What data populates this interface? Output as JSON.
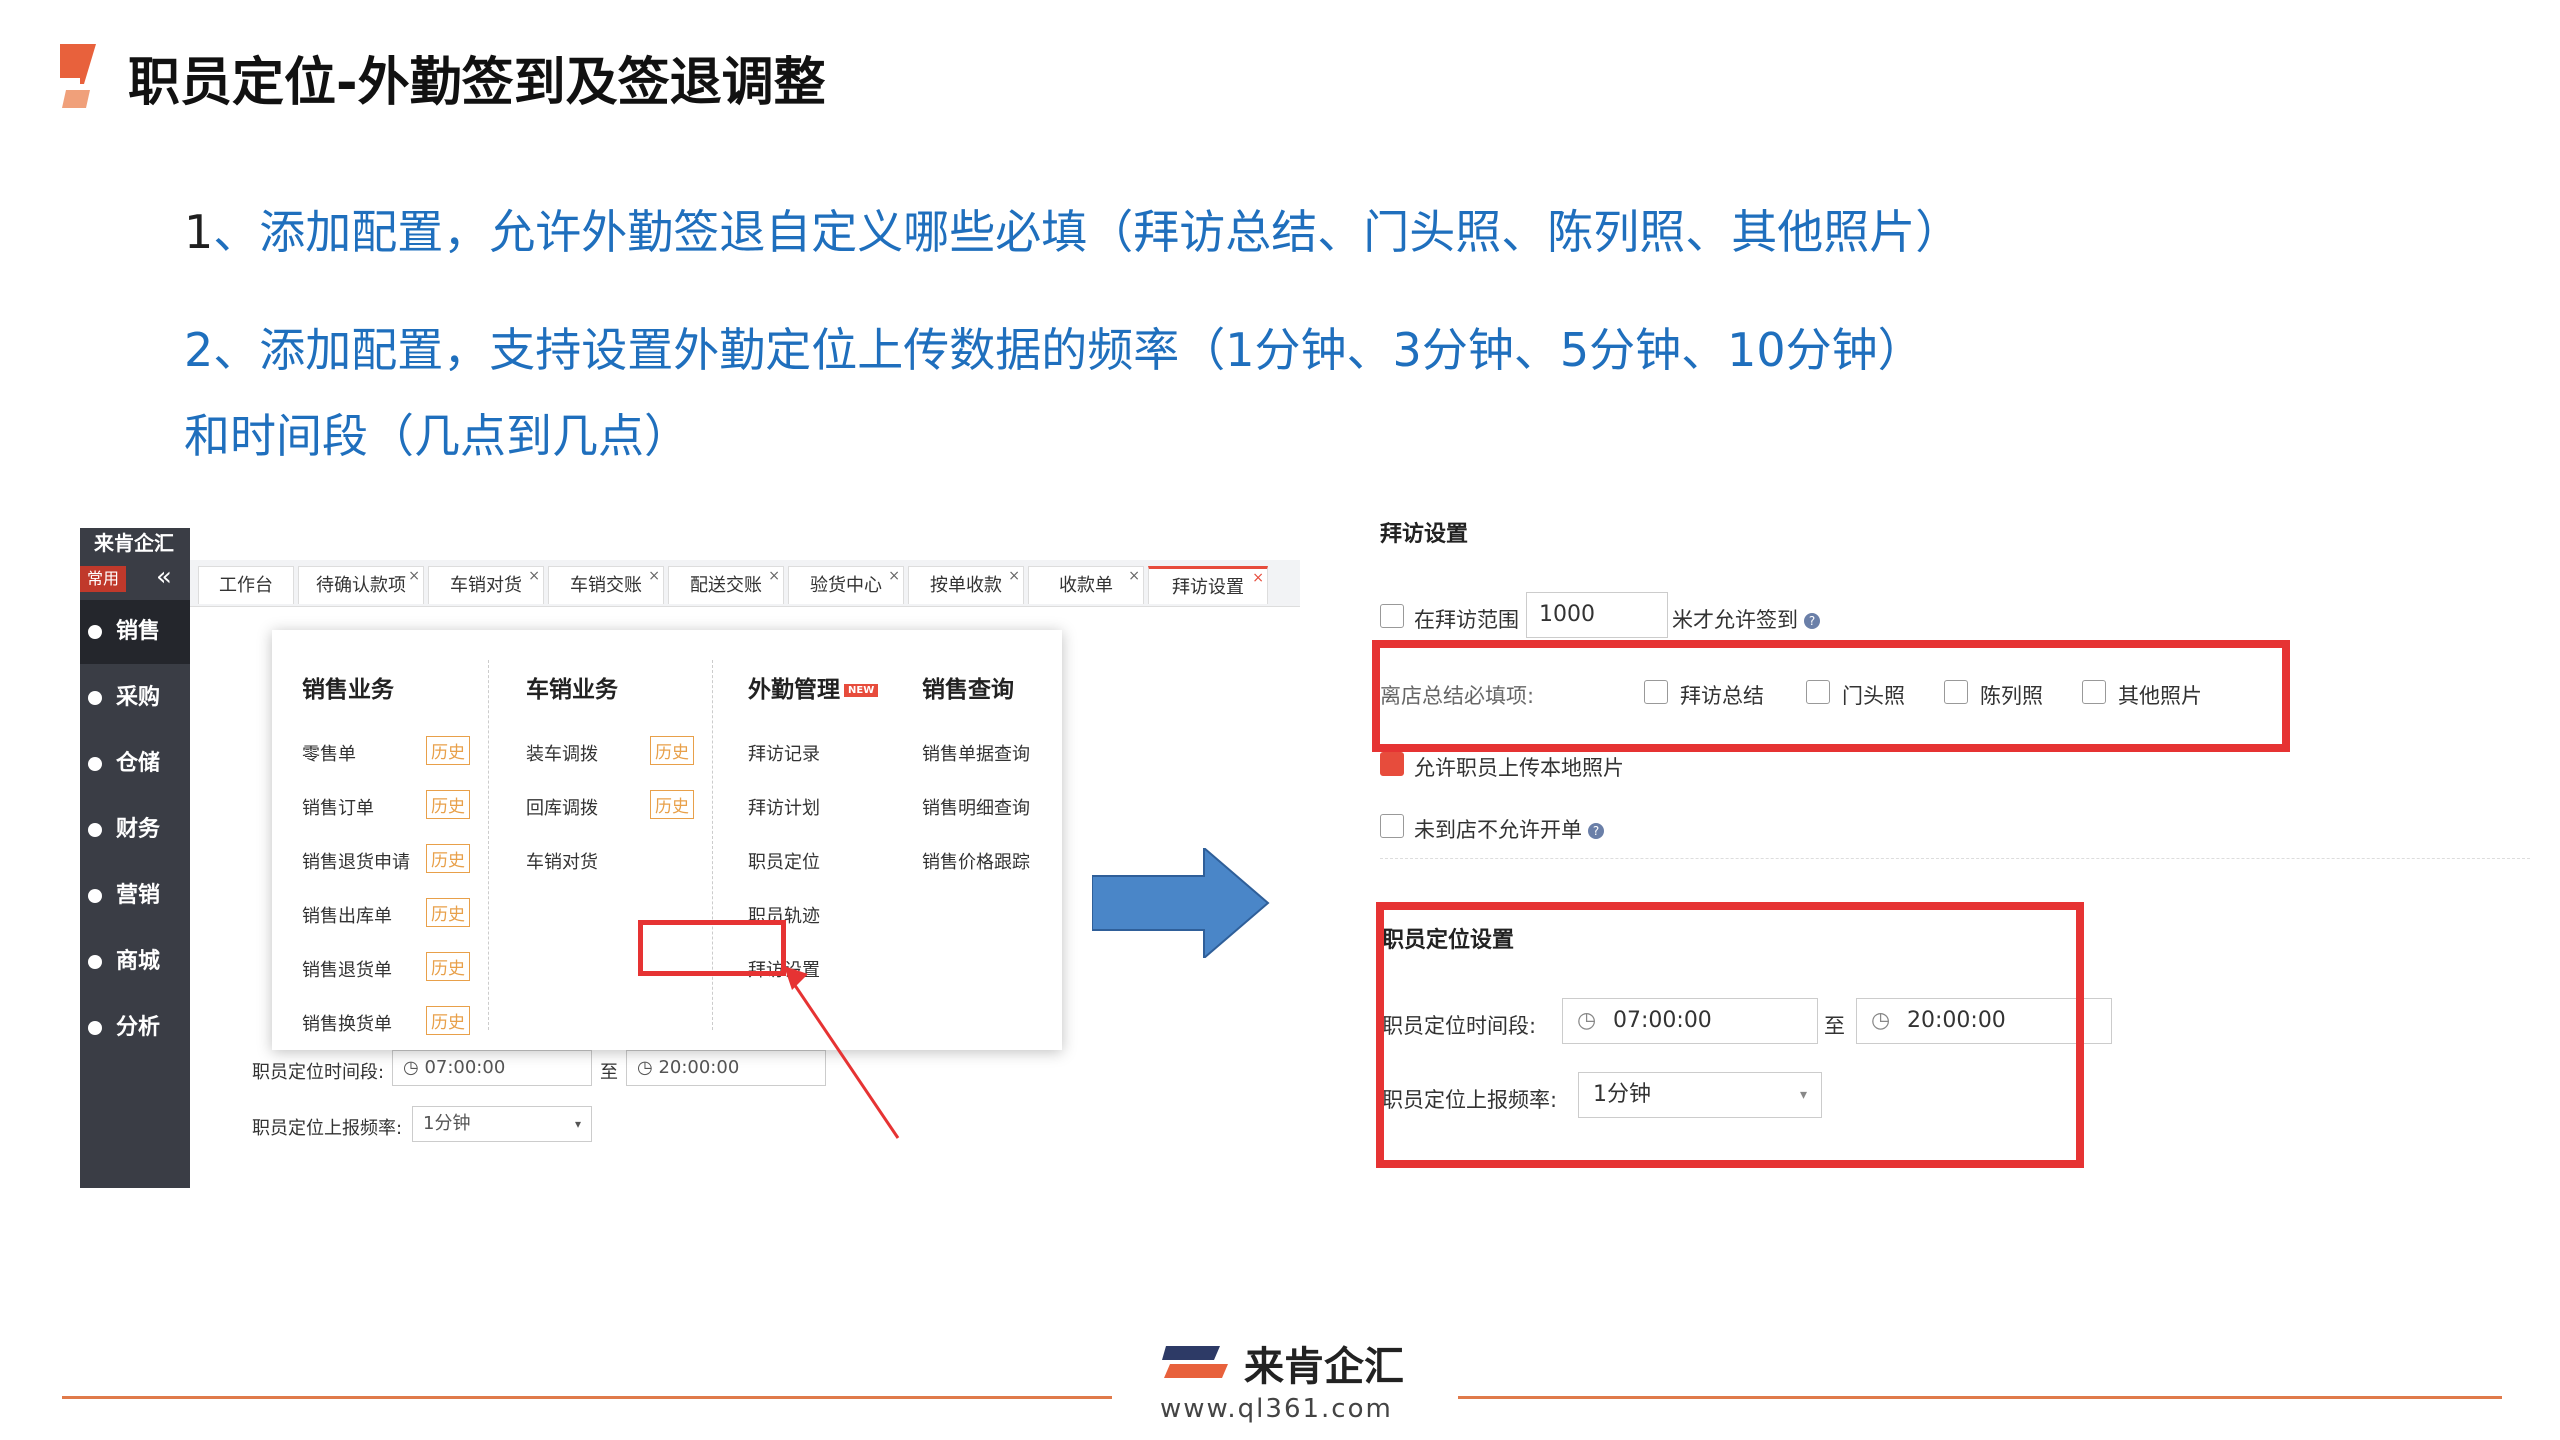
{
  "slide": {
    "title": "职员定位-外勤签到及签退调整",
    "point1_num": "1",
    "point1_text": "、添加配置，允许外勤签退自定义哪些必填（拜访总结、门头照、陈列照、其他照片）",
    "point2_num": "2",
    "point2_text": "、添加配置，支持设置外勤定位上传数据的频率（1分钟、3分钟、5分钟、10分钟）",
    "point2_text_line2": "和时间段（几点到几点）"
  },
  "left_app": {
    "brand": "来肯企汇",
    "changyong": "常用",
    "collapse_glyph": "«",
    "nav": [
      {
        "label": "销售"
      },
      {
        "label": "采购"
      },
      {
        "label": "仓储"
      },
      {
        "label": "财务"
      },
      {
        "label": "营销"
      },
      {
        "label": "商城"
      },
      {
        "label": "分析"
      }
    ],
    "tabs": [
      {
        "label": "工作台"
      },
      {
        "label": "待确认款项"
      },
      {
        "label": "车销对货"
      },
      {
        "label": "车销交账"
      },
      {
        "label": "配送交账"
      },
      {
        "label": "验货中心"
      },
      {
        "label": "按单收款"
      },
      {
        "label": "收款单"
      },
      {
        "label": "拜访设置"
      }
    ],
    "menu": {
      "sales": {
        "title": "销售业务",
        "items": [
          "零售单",
          "销售订单",
          "销售退货申请",
          "销售出库单",
          "销售退货单",
          "销售换货单"
        ],
        "history": "历史"
      },
      "car": {
        "title": "车销业务",
        "items": [
          "装车调拨",
          "回库调拨",
          "车销对货"
        ],
        "history": "历史"
      },
      "field": {
        "title": "外勤管理",
        "badge": "NEW",
        "items": [
          "拜访记录",
          "拜访计划",
          "职员定位",
          "职员轨迹",
          "拜访设置"
        ]
      },
      "query": {
        "title": "销售查询",
        "items": [
          "销售单据查询",
          "销售明细查询",
          "销售价格跟踪"
        ]
      }
    },
    "form": {
      "time_label": "职员定位时间段:",
      "start": "07:00:00",
      "to": "至",
      "end": "20:00:00",
      "freq_label": "职员定位上报频率:",
      "freq": "1分钟"
    }
  },
  "right_app": {
    "visit_title": "拜访设置",
    "range_label": "在拜访范围",
    "range_value": "1000",
    "range_suffix": "米才允许签到",
    "leave_label": "离店总结必填项:",
    "options": [
      "拜访总结",
      "门头照",
      "陈列照",
      "其他照片"
    ],
    "allow_upload": "允许职员上传本地照片",
    "not_arrive": "未到店不允许开单",
    "loc_title": "职员定位设置",
    "time_label": "职员定位时间段:",
    "start": "07:00:00",
    "to": "至",
    "end": "20:00:00",
    "freq_label": "职员定位上报频率:",
    "freq": "1分钟"
  },
  "footer": {
    "brand": "来肯企汇",
    "url": "www.ql361.com"
  },
  "colors": {
    "accent_blue": "#1f6fbd",
    "highlight_red": "#e63333",
    "footer_orange": "#e07a4a",
    "sidebar": "#3a3d45"
  }
}
